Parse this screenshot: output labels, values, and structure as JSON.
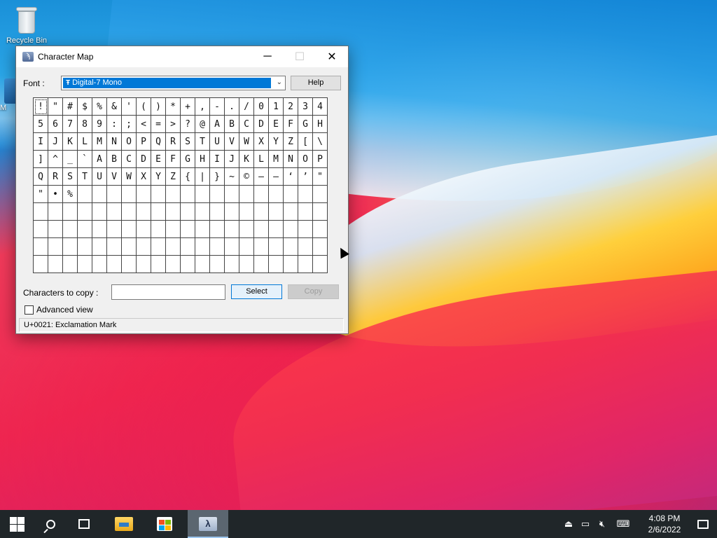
{
  "desktop": {
    "icons": [
      {
        "label": "Recycle Bin",
        "icon": "recycle-bin-icon"
      },
      {
        "label": "M",
        "icon": "shortcut-icon"
      }
    ]
  },
  "window": {
    "title": "Character Map",
    "app_icon": "charmap-icon",
    "controls": {
      "minimize": "─",
      "maximize": "☐",
      "close": "✕"
    },
    "font_label": "Font :",
    "font_value": "Digital-7 Mono",
    "font_type_glyph": "Ŧ",
    "help_label": "Help",
    "grid_rows": [
      [
        "!",
        "\"",
        "#",
        "$",
        "%",
        "&",
        "'",
        "(",
        ")",
        "*",
        "+",
        ",",
        "-",
        ".",
        "/",
        "0",
        "1",
        "2",
        "3",
        "4"
      ],
      [
        "5",
        "6",
        "7",
        "8",
        "9",
        ":",
        ";",
        "<",
        "=",
        ">",
        "?",
        "@",
        "A",
        "B",
        "C",
        "D",
        "E",
        "F",
        "G",
        "H"
      ],
      [
        "I",
        "J",
        "K",
        "L",
        "M",
        "N",
        "O",
        "P",
        "Q",
        "R",
        "S",
        "T",
        "U",
        "V",
        "W",
        "X",
        "Y",
        "Z",
        "[",
        "\\"
      ],
      [
        "]",
        "^",
        "_",
        "`",
        "A",
        "B",
        "C",
        "D",
        "E",
        "F",
        "G",
        "H",
        "I",
        "J",
        "K",
        "L",
        "M",
        "N",
        "O",
        "P"
      ],
      [
        "Q",
        "R",
        "S",
        "T",
        "U",
        "V",
        "W",
        "X",
        "Y",
        "Z",
        "{",
        "|",
        "}",
        "~",
        "©",
        "–",
        "—",
        "‘",
        "’",
        "\""
      ],
      [
        "\"",
        "•",
        "%",
        "",
        "",
        "",
        "",
        "",
        "",
        "",
        "",
        "",
        "",
        "",
        "",
        "",
        "",
        "",
        "",
        ""
      ],
      [
        "",
        "",
        "",
        "",
        "",
        "",
        "",
        "",
        "",
        "",
        "",
        "",
        "",
        "",
        "",
        "",
        "",
        "",
        "",
        ""
      ],
      [
        "",
        "",
        "",
        "",
        "",
        "",
        "",
        "",
        "",
        "",
        "",
        "",
        "",
        "",
        "",
        "",
        "",
        "",
        "",
        ""
      ],
      [
        "",
        "",
        "",
        "",
        "",
        "",
        "",
        "",
        "",
        "",
        "",
        "",
        "",
        "",
        "",
        "",
        "",
        "",
        "",
        ""
      ],
      [
        "",
        "",
        "",
        "",
        "",
        "",
        "",
        "",
        "",
        "",
        "",
        "",
        "",
        "",
        "",
        "",
        "",
        "",
        "",
        ""
      ]
    ],
    "selected_char": "!",
    "copy_label": "Characters to copy :",
    "copy_value": "",
    "select_label": "Select",
    "copy_button_label": "Copy",
    "advanced_label": "Advanced view",
    "advanced_checked": false,
    "status": "U+0021: Exclamation Mark"
  },
  "taskbar": {
    "items": [
      {
        "name": "start-button",
        "icon": "windows-logo-icon"
      },
      {
        "name": "search-button",
        "icon": "search-icon"
      },
      {
        "name": "task-view-button",
        "icon": "task-view-icon"
      },
      {
        "name": "file-explorer-button",
        "icon": "folder-icon"
      },
      {
        "name": "store-button",
        "icon": "store-bag-icon"
      },
      {
        "name": "character-map-button",
        "icon": "charmap-icon",
        "glyph": "λ"
      }
    ],
    "tray_icons": [
      "usb-icon",
      "network-icon",
      "volume-muted-icon",
      "keyboard-icon"
    ],
    "time": "4:08 PM",
    "date": "2/6/2022"
  }
}
